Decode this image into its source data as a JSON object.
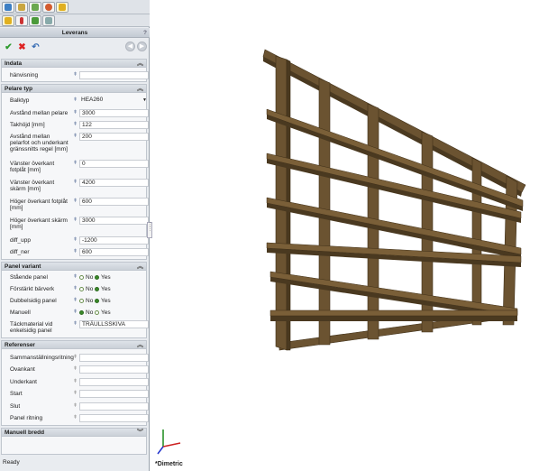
{
  "tabs_row1": [
    "feature-manager-icon",
    "property-manager-icon",
    "configuration-manager-icon",
    "appearance-icon",
    "custom-icon"
  ],
  "tabs_row2": [
    "tab-a-icon",
    "tab-b-icon",
    "tab-c-icon",
    "tab-d-icon"
  ],
  "panel_title": "Leverans",
  "help_label": "?",
  "sections": {
    "indata": {
      "title": "Indata",
      "fields": [
        {
          "label": "hänvisning",
          "value": ""
        }
      ]
    },
    "pelare_typ": {
      "title": "Pelare typ",
      "fields": [
        {
          "label": "Balktyp",
          "value": "HEA260"
        },
        {
          "label": "Avstånd mellan pelare",
          "value": "3000"
        },
        {
          "label": "Takhöjd [mm]",
          "value": "122"
        },
        {
          "label": "Avstånd mellan pelarfot och underkant gränssnitts regel [mm]",
          "value": "200"
        },
        {
          "label": "Vänster överkant fotplåt [mm]",
          "value": "0"
        },
        {
          "label": "Vänster överkant skärm [mm]",
          "value": "4200"
        },
        {
          "label": "Höger överkant fotplåt [mm]",
          "value": "600"
        },
        {
          "label": "Höger överkant skärm [mm]",
          "value": "3000"
        },
        {
          "label": "diff_upp",
          "value": "-1200"
        },
        {
          "label": "diff_ner",
          "value": "600"
        }
      ]
    },
    "panel_variant": {
      "title": "Panel variant",
      "radios": [
        {
          "label": "Stående panel",
          "no": "No",
          "yes": "Yes",
          "selected": "yes"
        },
        {
          "label": "Förstärkt bärverk",
          "no": "No",
          "yes": "Yes",
          "selected": "yes"
        },
        {
          "label": "Dubbelsidig panel",
          "no": "No",
          "yes": "Yes",
          "selected": "yes"
        },
        {
          "label": "Manuell",
          "no": "No",
          "yes": "Yes",
          "selected": "no"
        }
      ],
      "material_label": "Täckmaterial vid enkelsidig panel",
      "material_value": "TRÄULLSSKIVA"
    },
    "referenser": {
      "title": "Referenser",
      "fields": [
        {
          "label": "Sammanställningsritning",
          "value": ""
        },
        {
          "label": "Ovankant",
          "value": ""
        },
        {
          "label": "Underkant",
          "value": ""
        },
        {
          "label": "Start",
          "value": ""
        },
        {
          "label": "Slut",
          "value": ""
        },
        {
          "label": "Panel ritning",
          "value": ""
        }
      ]
    },
    "manuell_bredd": {
      "title": "Manuell bredd"
    }
  },
  "status": "Ready",
  "view_label": "*Dimetric",
  "colors": {
    "wood": "#6b5331",
    "wood_dark": "#4a3920",
    "wood_light": "#8a6f45"
  }
}
